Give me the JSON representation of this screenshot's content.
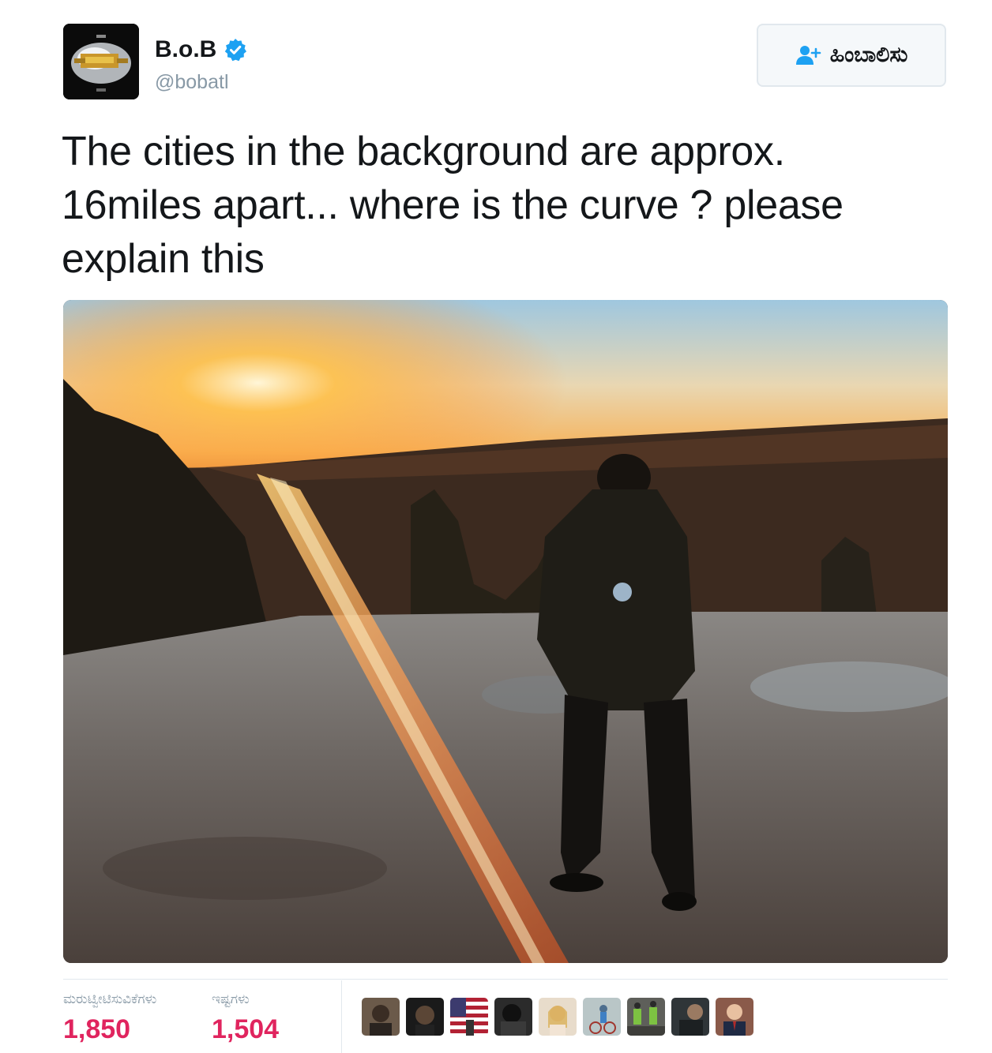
{
  "user": {
    "display_name": "B.o.B",
    "handle": "@bobatl",
    "verified": true,
    "avatar_icon": "album-cover-avatar"
  },
  "follow_button": {
    "label": "ಹಿಂಬಾಲಿಸು",
    "icon": "add-user-icon",
    "icon_color": "#1da1f2"
  },
  "tweet": {
    "text": "The cities in the background are approx. 16miles apart... where is the curve ? please explain this"
  },
  "media": {
    "description_icon": "sunset-photo"
  },
  "stats": {
    "retweets_label": "ಮರುಟ್ವೀಟಿಸುವಿಕೆಗಳು",
    "retweets_count": "1,850",
    "likes_label": "ಇಷ್ಟಗಳು",
    "likes_count": "1,504",
    "count_color": "#e0245e"
  },
  "favoriters": [
    {
      "icon": "user-avatar"
    },
    {
      "icon": "user-avatar"
    },
    {
      "icon": "flag-avatar"
    },
    {
      "icon": "user-avatar"
    },
    {
      "icon": "user-avatar"
    },
    {
      "icon": "user-avatar"
    },
    {
      "icon": "user-avatar"
    },
    {
      "icon": "user-avatar"
    },
    {
      "icon": "user-avatar"
    }
  ]
}
